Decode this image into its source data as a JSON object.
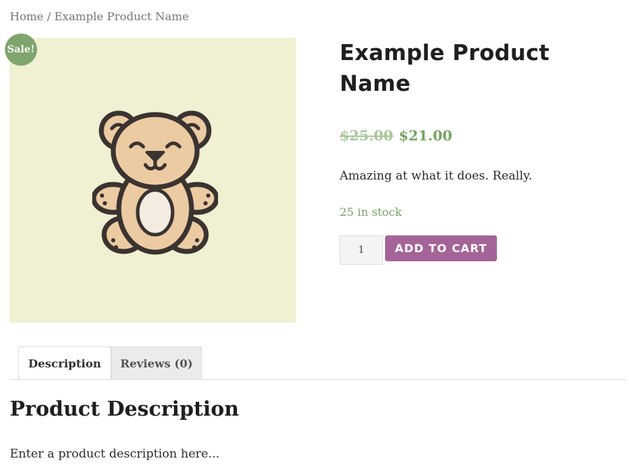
{
  "breadcrumb": {
    "home": "Home",
    "separator": "/",
    "current": "Example Product Name"
  },
  "gallery": {
    "badge": "Sale!",
    "image_icon": "teddy-bear-icon",
    "background": "#f0f0d2"
  },
  "product": {
    "title": "Example Product Name",
    "old_price": "$25.00",
    "price": "$21.00",
    "short_description": "Amazing at what it does. Really.",
    "stock": "25 in stock",
    "quantity": "1",
    "add_to_cart_label": "ADD TO CART"
  },
  "tabs": [
    {
      "label": "Description",
      "active": true
    },
    {
      "label": "Reviews (0)",
      "active": false
    }
  ],
  "description": {
    "heading": "Product Description",
    "text": "Enter a product description here..."
  },
  "colors": {
    "accent_green": "#77a464",
    "button_purple": "#a46497",
    "badge_green": "#7fa56d"
  }
}
